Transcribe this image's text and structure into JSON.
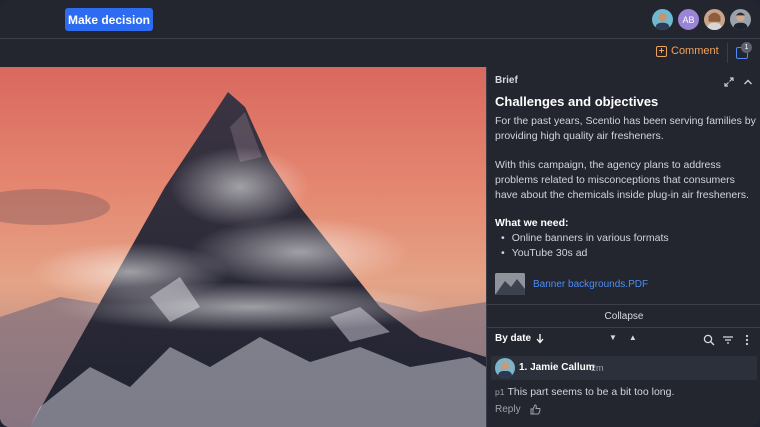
{
  "toolbar": {
    "decision_label": "Make decision"
  },
  "avatars": [
    {
      "name": "avatar-user-1",
      "initials": ""
    },
    {
      "name": "avatar-user-ab",
      "initials": "AB"
    },
    {
      "name": "avatar-user-3",
      "initials": ""
    },
    {
      "name": "avatar-user-4",
      "initials": ""
    }
  ],
  "subbar": {
    "comment_label": "Comment",
    "notification_count": "1"
  },
  "brief": {
    "header": "Brief",
    "title": "Challenges and objectives",
    "paragraph_1": "For the past years, Scentio has been serving families by providing high quality air fresheners.",
    "paragraph_2": "With this campaign, the agency plans to address problems related to misconceptions that consumers have about the chemicals inside plug-in air fresheners.",
    "needs_title": "What we need:",
    "needs": [
      "Online banners in various formats",
      "YouTube 30s ad"
    ],
    "attachment_name": "Banner backgrounds.PDF",
    "collapse_label": "Collapse"
  },
  "filters": {
    "sort_label": "By date"
  },
  "comment": {
    "author": "1. Jamie Callum",
    "time": "2m",
    "page_ref": "p1",
    "text": "This part seems to be a bit too long.",
    "reply_label": "Reply"
  },
  "colors": {
    "accent": "#2d6bf0",
    "comment_orange": "#f0a25c",
    "link_blue": "#4d8df5",
    "panel_bg": "#23262f"
  }
}
